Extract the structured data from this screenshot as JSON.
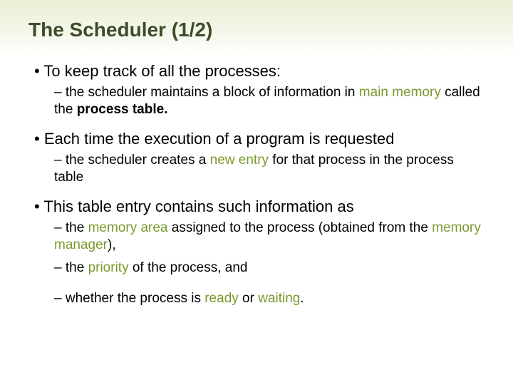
{
  "title": "The Scheduler (1/2)",
  "b1": "To keep track of all the processes:",
  "b1s1_a": "the scheduler maintains a block of information in ",
  "b1s1_b": "main memory",
  "b1s1_c": " called the ",
  "b1s1_d": "process table.",
  "b2": "Each time the execution of a program is requested",
  "b2s1_a": "the scheduler creates a ",
  "b2s1_b": "new entry",
  "b2s1_c": " for that process in the process table",
  "b3": "This table entry contains such information as",
  "b3s1_a": "the ",
  "b3s1_b": "memory area",
  "b3s1_c": " assigned to the process (obtained from the ",
  "b3s1_d": "memory manager",
  "b3s1_e": "),",
  "b3s2_a": "the ",
  "b3s2_b": "priority",
  "b3s2_c": " of the process, and",
  "b3s3_a": "whether the process is ",
  "b3s3_b": "ready",
  "b3s3_c": " or ",
  "b3s3_d": "waiting",
  "b3s3_e": "."
}
